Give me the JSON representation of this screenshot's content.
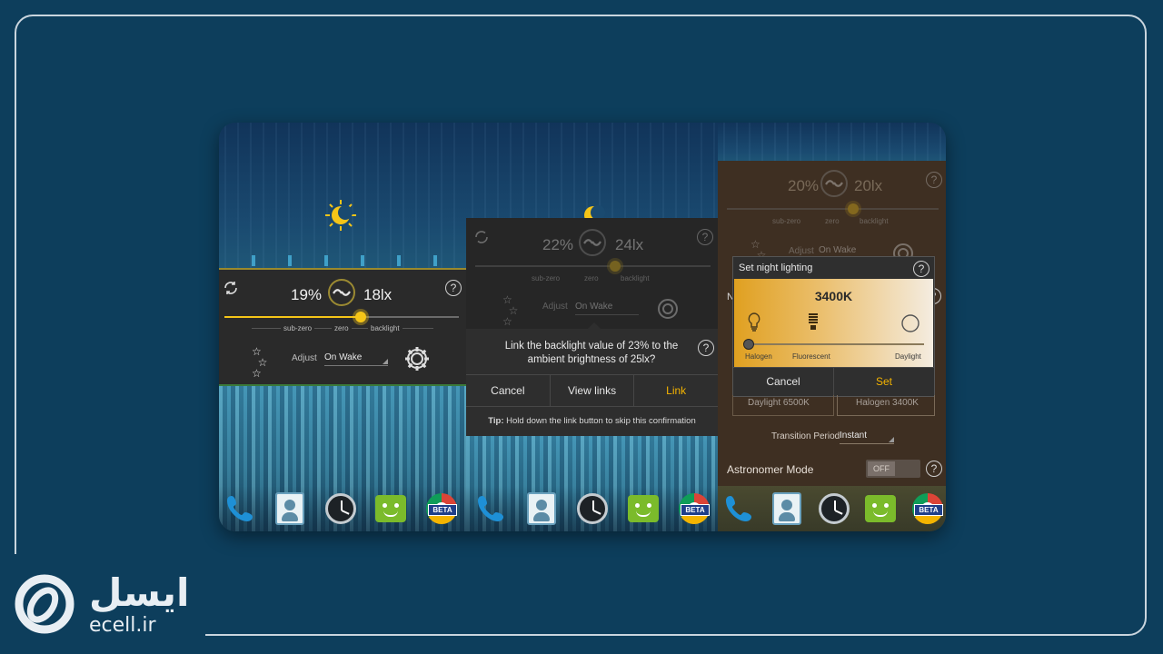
{
  "brand": {
    "name_fa": "ایسل",
    "domain": "ecell.ir"
  },
  "dock": {
    "icons": [
      "phone-icon",
      "contacts-icon",
      "clock-icon",
      "messaging-icon",
      "chrome-beta-icon"
    ],
    "beta_label": "BETA"
  },
  "panel1": {
    "backlight": "19%",
    "ambient": "18lx",
    "slider_position": 0.6,
    "scale": [
      "sub-zero",
      "zero",
      "backlight"
    ],
    "adjust_label": "Adjust",
    "adjust_value": "On Wake"
  },
  "panel2": {
    "backlight": "22%",
    "ambient": "24lx",
    "scale": [
      "sub-zero",
      "zero",
      "backlight"
    ],
    "adjust_label": "Adjust",
    "adjust_value": "On Wake",
    "dialog_message": "Link the backlight value of 23% to the ambient brightness of 25lx?",
    "buttons": {
      "cancel": "Cancel",
      "view_links": "View links",
      "link": "Link"
    },
    "tip_label": "Tip:",
    "tip_text": "Hold down the link button to skip this confirmation"
  },
  "panel3": {
    "backlight": "20%",
    "ambient": "20lx",
    "scale": [
      "sub-zero",
      "zero",
      "backlight"
    ],
    "adjust_label": "Adjust",
    "adjust_value": "On Wake",
    "dialog_title": "Set night lighting",
    "temperature": "3400K",
    "bulbs": [
      "Halogen",
      "Fluorescent",
      "Daylight"
    ],
    "buttons": {
      "cancel": "Cancel",
      "set": "Set"
    },
    "presets": [
      "Daylight 6500K",
      "Halogen 3400K"
    ],
    "transition_label": "Transition Period",
    "transition_value": "Instant",
    "astronomer_label": "Astronomer Mode",
    "astronomer_value": "OFF",
    "obscured_label": "N"
  },
  "colors": {
    "accent": "#f5c518",
    "panel_bg": "#2a2a2a",
    "page_bg": "#0d3e5c"
  }
}
